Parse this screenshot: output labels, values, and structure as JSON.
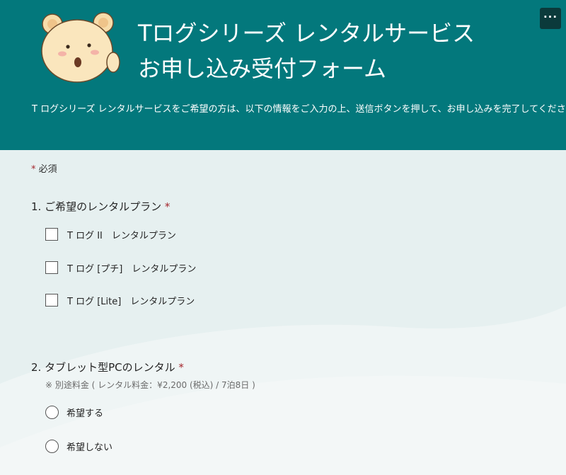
{
  "header": {
    "title_line1": "Tログシリーズ レンタルサービス",
    "title_line2": "お申し込み受付フォーム",
    "description": "T ログシリーズ レンタルサービスをご希望の方は、以下の情報をご入力の上、送信ボタンを押して、お申し込みを完了してください。",
    "more_label": "···"
  },
  "form": {
    "required_mark": "*",
    "required_label": "必須",
    "questions": [
      {
        "title": "1. ご希望のレンタルプラン",
        "required_mark": "*",
        "options": [
          "T ログ II　レンタルプラン",
          "T ログ [プチ]　レンタルプラン",
          "T ログ [Lite]　レンタルプラン"
        ]
      },
      {
        "title": "2. タブレット型PCのレンタル",
        "required_mark": "*",
        "hint": "※ 別途料金 ( レンタル料金：¥2,200 (税込) / 7泊8日 )",
        "options": [
          "希望する",
          "希望しない"
        ]
      }
    ]
  },
  "colors": {
    "header_bg": "#03787c",
    "page_bg": "#e6f0f0",
    "required_star": "#a4262c"
  }
}
